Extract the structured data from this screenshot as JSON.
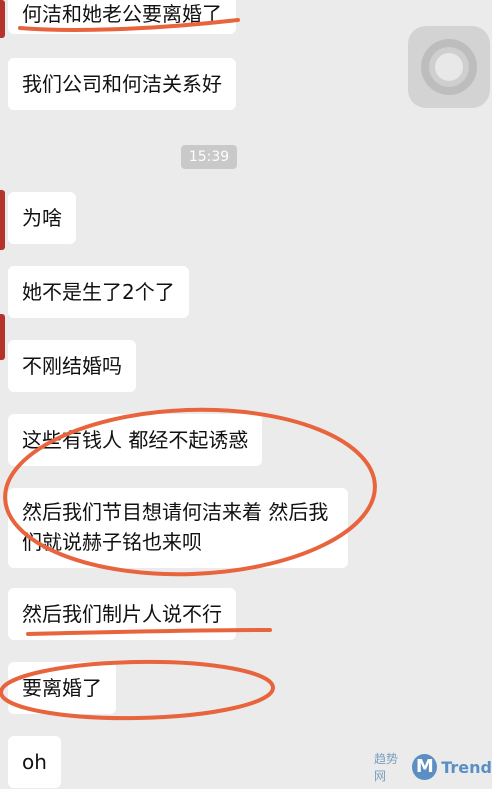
{
  "chat": {
    "messages": [
      {
        "text": "何洁和她老公要离婚了"
      },
      {
        "text": "我们公司和何洁关系好"
      },
      {
        "text": "为啥"
      },
      {
        "text": "她不是生了2个了"
      },
      {
        "text": "不刚结婚吗"
      },
      {
        "text": "这些有钱人 都经不起诱惑"
      },
      {
        "text": "然后我们节目想请何洁来着 然后我们就说赫子铭也来呗"
      },
      {
        "text": "然后我们制片人说不行"
      },
      {
        "text": "要离婚了"
      },
      {
        "text": "oh"
      }
    ],
    "timestamp": "15:39"
  },
  "watermark": {
    "site": "趋势网",
    "logo_letter": "M",
    "brand": "Trend"
  },
  "colors": {
    "annotation": "#e8643c",
    "bubble": "#ffffff",
    "background": "#ebebeb",
    "avatar": "#b4332a"
  }
}
